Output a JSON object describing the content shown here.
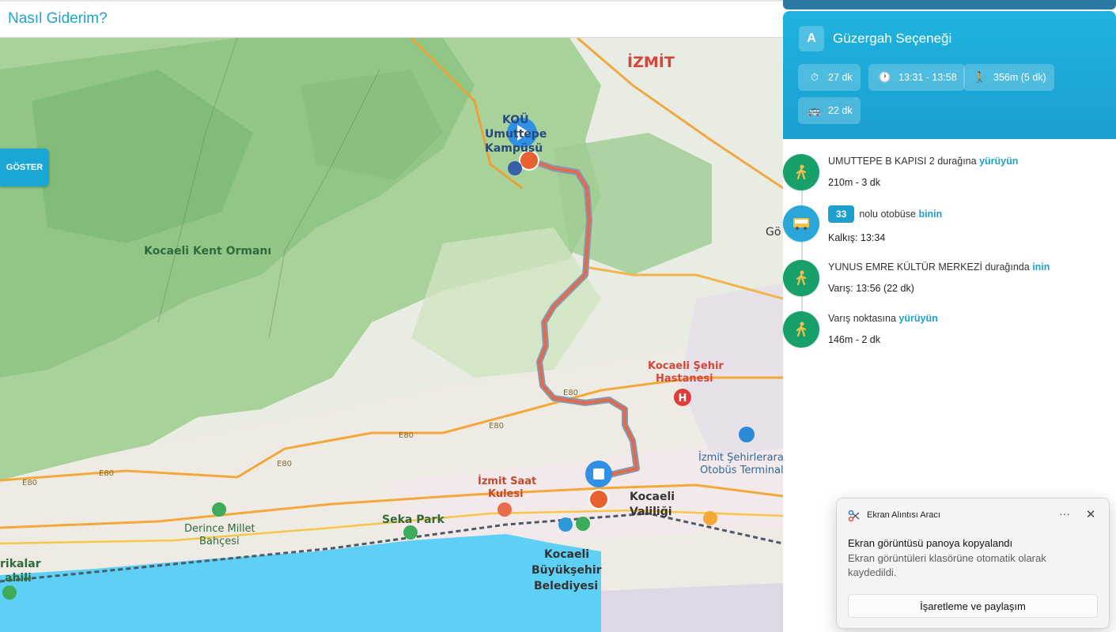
{
  "header": {
    "title": "Nasıl Giderim?"
  },
  "map": {
    "show_button_label": "GÖSTER",
    "labels": {
      "city": "İZMİT",
      "campus_line1": "KOÜ",
      "campus_line2": "Umuttepe",
      "campus_line3": "Kampüsü",
      "forest": "Kocaeli Kent Ormanı",
      "hospital_line1": "Kocaeli Şehir",
      "hospital_line2": "Hastanesi",
      "bus_terminal_line1": "İzmit Şehirlerarası",
      "bus_terminal_line2": "Otobüs Terminali",
      "clock_line1": "İzmit Saat",
      "clock_line2": "Kulesi",
      "governor_line1": "Kocaeli",
      "governor_line2": "Valiliği",
      "park": "Seka Park",
      "derince_line1": "Derince Millet",
      "derince_line2": "Bahçesi",
      "municipality_line1": "Kocaeli",
      "municipality_line2": "Büyükşehir",
      "municipality_line3": "Belediyesi",
      "shore_line1": "rikalar",
      "shore_line2": "ahili",
      "go_partial": "Gö",
      "road_e80": "E80"
    }
  },
  "route": {
    "letter": "A",
    "title": "Güzergah Seçeneği",
    "chips": [
      {
        "icon": "stopwatch-icon",
        "text": "27 dk"
      },
      {
        "icon": "clock-icon",
        "text": "13:31 - 13:58"
      },
      {
        "icon": "walk-icon",
        "text": "356m (5 dk)"
      },
      {
        "icon": "bus-icon",
        "text": "22 dk"
      }
    ]
  },
  "steps": [
    {
      "type": "walk",
      "text": "UMUTTEPE B KAPISI 2 durağına",
      "keyword": "yürüyün",
      "detail": "210m - 3 dk"
    },
    {
      "type": "bus",
      "badge": "33",
      "text": "nolu otobüse",
      "keyword": "binin",
      "detail": "Kalkış: 13:34"
    },
    {
      "type": "walk",
      "text": "YUNUS EMRE KÜLTÜR MERKEZİ durağında",
      "keyword": "inin",
      "detail": "Varış: 13:56 (22 dk)"
    },
    {
      "type": "walk",
      "text": "Varış noktasına",
      "keyword": "yürüyün",
      "detail": "146m - 2 dk"
    }
  ],
  "toast": {
    "app_name": "Ekran Alıntısı Aracı",
    "more": "···",
    "close": "✕",
    "title": "Ekran görüntüsü panoya kopyalandı",
    "body": "Ekran görüntüleri klasörüne otomatik olarak kaydedildi.",
    "action": "İşaretleme ve paylaşım"
  },
  "colors": {
    "accent": "#1da4cf",
    "walk": "#17a06a",
    "bus": "#2aa7d8",
    "route_line": "#e8674a",
    "sea": "#5fd0f5"
  }
}
